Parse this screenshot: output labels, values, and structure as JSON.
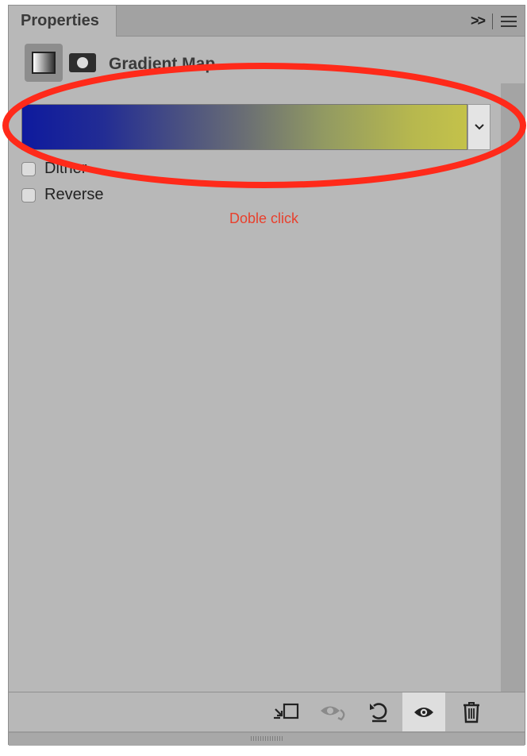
{
  "panel": {
    "tab_title": "Properties"
  },
  "header": {
    "title": "Gradient Map"
  },
  "gradient": {
    "stops": [
      "#0e1a9e",
      "#444b84",
      "#6a6e74",
      "#929a62",
      "#c4c24a"
    ]
  },
  "options": [
    {
      "label": "Dither",
      "checked": false
    },
    {
      "label": "Reverse",
      "checked": false
    }
  ],
  "annotation": {
    "text": "Doble click",
    "color": "#e8402d",
    "ring_color": "#ff2a1a"
  },
  "toolbar": {
    "items": [
      "clip-to-layer-icon",
      "view-previous-state-icon",
      "reset-icon",
      "toggle-visibility-icon",
      "delete-icon"
    ],
    "active": "toggle-visibility-icon"
  }
}
